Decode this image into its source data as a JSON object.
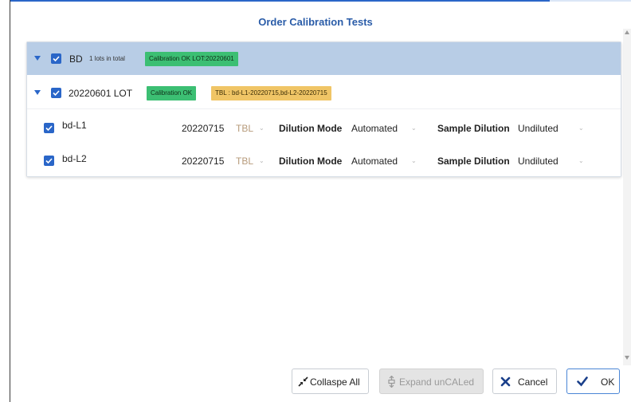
{
  "dialog": {
    "title": "Order Calibration Tests"
  },
  "group": {
    "name": "BD",
    "lots_text": "1 lots in total",
    "status_tag": "Calibration OK LOT:20220601"
  },
  "lot": {
    "name": "20220601 LOT",
    "status_tag": "Calibration OK",
    "tbl_tag": "TBL : bd-L1-20220715,bd-L2-20220715"
  },
  "items": [
    {
      "name": "bd-L1",
      "date": "20220715",
      "tbl": "TBL",
      "dilution_mode_label": "Dilution Mode",
      "dilution_mode_value": "Automated",
      "sample_dilution_label": "Sample Dilution",
      "sample_dilution_value": "Undiluted"
    },
    {
      "name": "bd-L2",
      "date": "20220715",
      "tbl": "TBL",
      "dilution_mode_label": "Dilution Mode",
      "dilution_mode_value": "Automated",
      "sample_dilution_label": "Sample Dilution",
      "sample_dilution_value": "Undiluted"
    }
  ],
  "buttons": {
    "collapse_all": "Collaspe All",
    "expand_uncaled": "Expand unCALed",
    "cancel": "Cancel",
    "ok": "OK"
  },
  "colors": {
    "accent": "#2a66c8",
    "header_row": "#b8cde6",
    "tag_green": "#3cbf73",
    "tag_yellow": "#f0c566",
    "title": "#2a5ca8"
  }
}
